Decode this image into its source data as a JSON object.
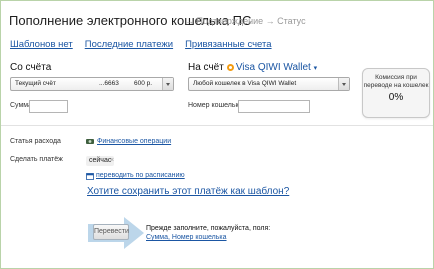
{
  "header": {
    "title": "Пополнение электронного кошелька ПС",
    "breadcrumbs": "→ Подтверждение → Статус"
  },
  "tabs": [
    {
      "label": "Шаблонов нет"
    },
    {
      "label": "Последние платежи"
    },
    {
      "label": "Привязанные счета"
    }
  ],
  "from": {
    "heading": "Со счёта",
    "account_label": "Текущий счёт",
    "account_number": "...6663",
    "balance": "600 р.",
    "amount_label": "Сумма"
  },
  "to": {
    "heading_prefix": "На счёт",
    "wallet_name": "Visa QIWI Wallet",
    "caret": "▾",
    "selected_wallet": "Любой кошелек в Visa QIWI Wallet",
    "number_label": "Номер кошелька"
  },
  "commission": {
    "text": "Комиссия при переводе на кошелек",
    "value": "0%"
  },
  "details": {
    "category_label": "Статья расхода",
    "category_link": "Финансовые операции",
    "make_payment_label": "Сделать платёж",
    "make_payment_value": "сейчас",
    "remove_symbol": "×",
    "schedule_link": "переводить по расписанию",
    "save_template_question": "Хотите сохранить этот платёж как шаблон?"
  },
  "actions": {
    "transfer_label": "Перевести",
    "hint": "Прежде заполните, пожалуйста, поля:",
    "hint_fields": "Сумма, Номер кошелька"
  },
  "colors": {
    "link": "#1b56a3",
    "border_accent": "#b9d3a9",
    "arrow": "#bcd6ea",
    "qiwi": "#f39c12"
  }
}
